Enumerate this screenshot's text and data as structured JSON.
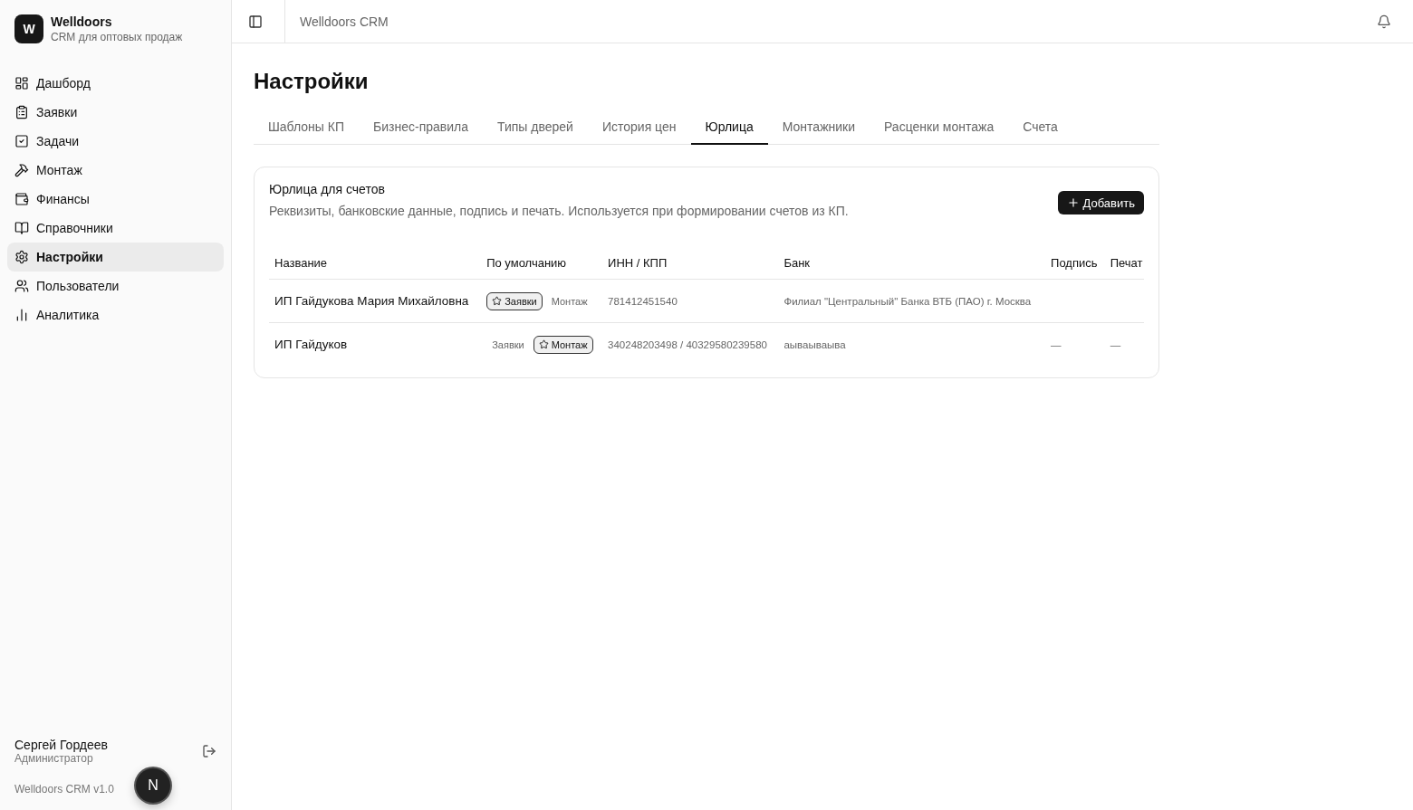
{
  "brand": {
    "logo": "W",
    "name": "Welldoors",
    "subtitle": "CRM для оптовых продаж"
  },
  "nav": [
    {
      "label": "Дашборд",
      "selected": false
    },
    {
      "label": "Заявки",
      "selected": false
    },
    {
      "label": "Задачи",
      "selected": false
    },
    {
      "label": "Монтаж",
      "selected": false
    },
    {
      "label": "Финансы",
      "selected": false
    },
    {
      "label": "Справочники",
      "selected": false
    },
    {
      "label": "Настройки",
      "selected": true
    },
    {
      "label": "Пользователи",
      "selected": false
    },
    {
      "label": "Аналитика",
      "selected": false
    }
  ],
  "user": {
    "name": "Сергей Гордеев",
    "role": "Администратор"
  },
  "version": "Welldoors CRM v1.0",
  "dev_badge": "N",
  "header": {
    "title": "Welldoors CRM"
  },
  "page_title": "Настройки",
  "tabs": [
    {
      "label": "Шаблоны КП",
      "selected": false
    },
    {
      "label": "Бизнес-правила",
      "selected": false
    },
    {
      "label": "Типы дверей",
      "selected": false
    },
    {
      "label": "История цен",
      "selected": false
    },
    {
      "label": "Юрлица",
      "selected": true
    },
    {
      "label": "Монтажники",
      "selected": false
    },
    {
      "label": "Расценки монтажа",
      "selected": false
    },
    {
      "label": "Счета",
      "selected": false
    }
  ],
  "card": {
    "title": "Юрлица для счетов",
    "description": "Реквизиты, банковские данные, подпись и печать. Используется при формировании счетов из КП.",
    "add_button": "Добавить"
  },
  "table": {
    "columns": [
      "Название",
      "По умолчанию",
      "ИНН / КПП",
      "Банк",
      "Подпись",
      "Печат"
    ],
    "rows": [
      {
        "name": "ИП Гайдукова Мария Михайловна",
        "defaults": [
          {
            "label": "Заявки",
            "selected": true
          },
          {
            "label": "Монтаж",
            "selected": false
          }
        ],
        "inn": "781412451540",
        "bank": "Филиал \"Центральный\" Банка ВТБ (ПАО) г. Москва"
      },
      {
        "name": "ИП Гайдуков",
        "defaults": [
          {
            "label": "Заявки",
            "selected": false
          },
          {
            "label": "Монтаж",
            "selected": true
          }
        ],
        "inn": "340248203498 / 40329580239580",
        "bank": "аываываыва",
        "signature": "—",
        "stamp": "—"
      }
    ]
  }
}
